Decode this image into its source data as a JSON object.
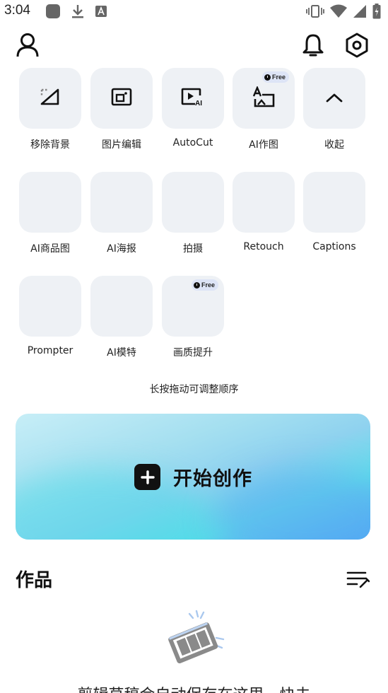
{
  "status_bar": {
    "time": "3:04",
    "left_icons": [
      "app-notification-icon",
      "download-icon",
      "text-a-icon"
    ],
    "right_icons": [
      "vibrate-icon",
      "wifi-icon",
      "signal-icon",
      "battery-icon"
    ]
  },
  "header": {
    "profile_icon": "person-icon",
    "notification_icon": "bell-icon",
    "settings_icon": "hexagon-settings-icon"
  },
  "tools": [
    {
      "label": "移除背景",
      "icon": "remove-background-icon",
      "free": false
    },
    {
      "label": "图片编辑",
      "icon": "image-edit-icon",
      "free": false
    },
    {
      "label": "AutoCut",
      "icon": "autocut-icon",
      "free": false
    },
    {
      "label": "AI作图",
      "icon": "ai-drawing-icon",
      "free": true
    },
    {
      "label": "收起",
      "icon": "chevron-up-icon",
      "free": false
    },
    {
      "label": "AI商品图",
      "icon": "",
      "free": false
    },
    {
      "label": "AI海报",
      "icon": "",
      "free": false
    },
    {
      "label": "拍摄",
      "icon": "",
      "free": false
    },
    {
      "label": "Retouch",
      "icon": "",
      "free": false
    },
    {
      "label": "Captions",
      "icon": "",
      "free": false
    },
    {
      "label": "Prompter",
      "icon": "",
      "free": false
    },
    {
      "label": "AI模特",
      "icon": "",
      "free": false
    },
    {
      "label": "画质提升",
      "icon": "",
      "free": true
    }
  ],
  "free_badge_text": "Free",
  "reorder_hint": "长按拖动可调整顺序",
  "create_banner": {
    "label": "开始创作",
    "icon": "plus-icon"
  },
  "works": {
    "title": "作品",
    "sort_icon": "sort-list-icon",
    "empty_icon": "film-strip-icon",
    "empty_text": "剪辑草稿会自动保存在这里，快去"
  }
}
